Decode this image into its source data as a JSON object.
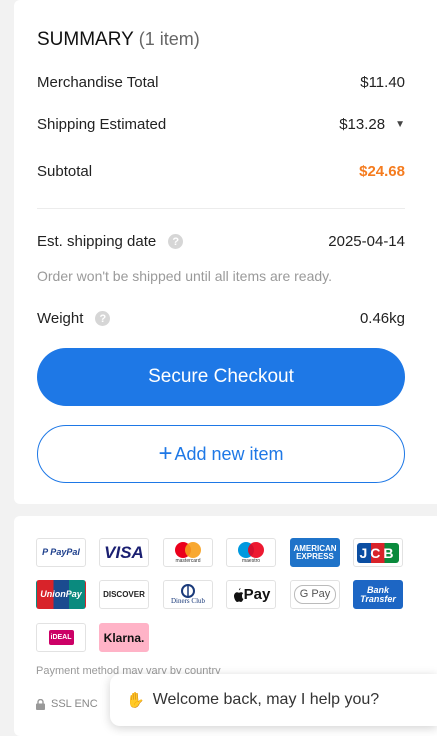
{
  "summary": {
    "title": "SUMMARY",
    "item_count": "(1 item)",
    "merchandise_label": "Merchandise Total",
    "merchandise_value": "$11.40",
    "shipping_label": "Shipping Estimated",
    "shipping_value": "$13.28",
    "subtotal_label": "Subtotal",
    "subtotal_value": "$24.68",
    "ship_date_label": "Est. shipping date",
    "ship_date_value": "2025-04-14",
    "ship_note": "Order won't be shipped until all items are ready.",
    "weight_label": "Weight",
    "weight_value": "0.46kg",
    "checkout_label": "Secure Checkout",
    "add_item_label": "Add new item",
    "help_glyph": "?"
  },
  "payment": {
    "methods": {
      "paypal": "P PayPal",
      "visa": "VISA",
      "mastercard": "mastercard",
      "maestro": "maestro",
      "amex": "AMERICAN EXPRESS",
      "jcb": "JCB",
      "unionpay": "UnionPay",
      "discover": "DISCOVER",
      "diners": "Diners Club",
      "applepay": "Pay",
      "gpay": "G Pay",
      "bank": "Bank Transfer",
      "ideal": "iDEAL",
      "klarna": "Klarna."
    },
    "note": "Payment method may vary by country",
    "ssl_label": "SSL ENC"
  },
  "chat": {
    "message": "Welcome back, may I help you?"
  },
  "colors": {
    "primary_blue": "#1e78e6",
    "subtotal_orange": "#f57c1f"
  }
}
